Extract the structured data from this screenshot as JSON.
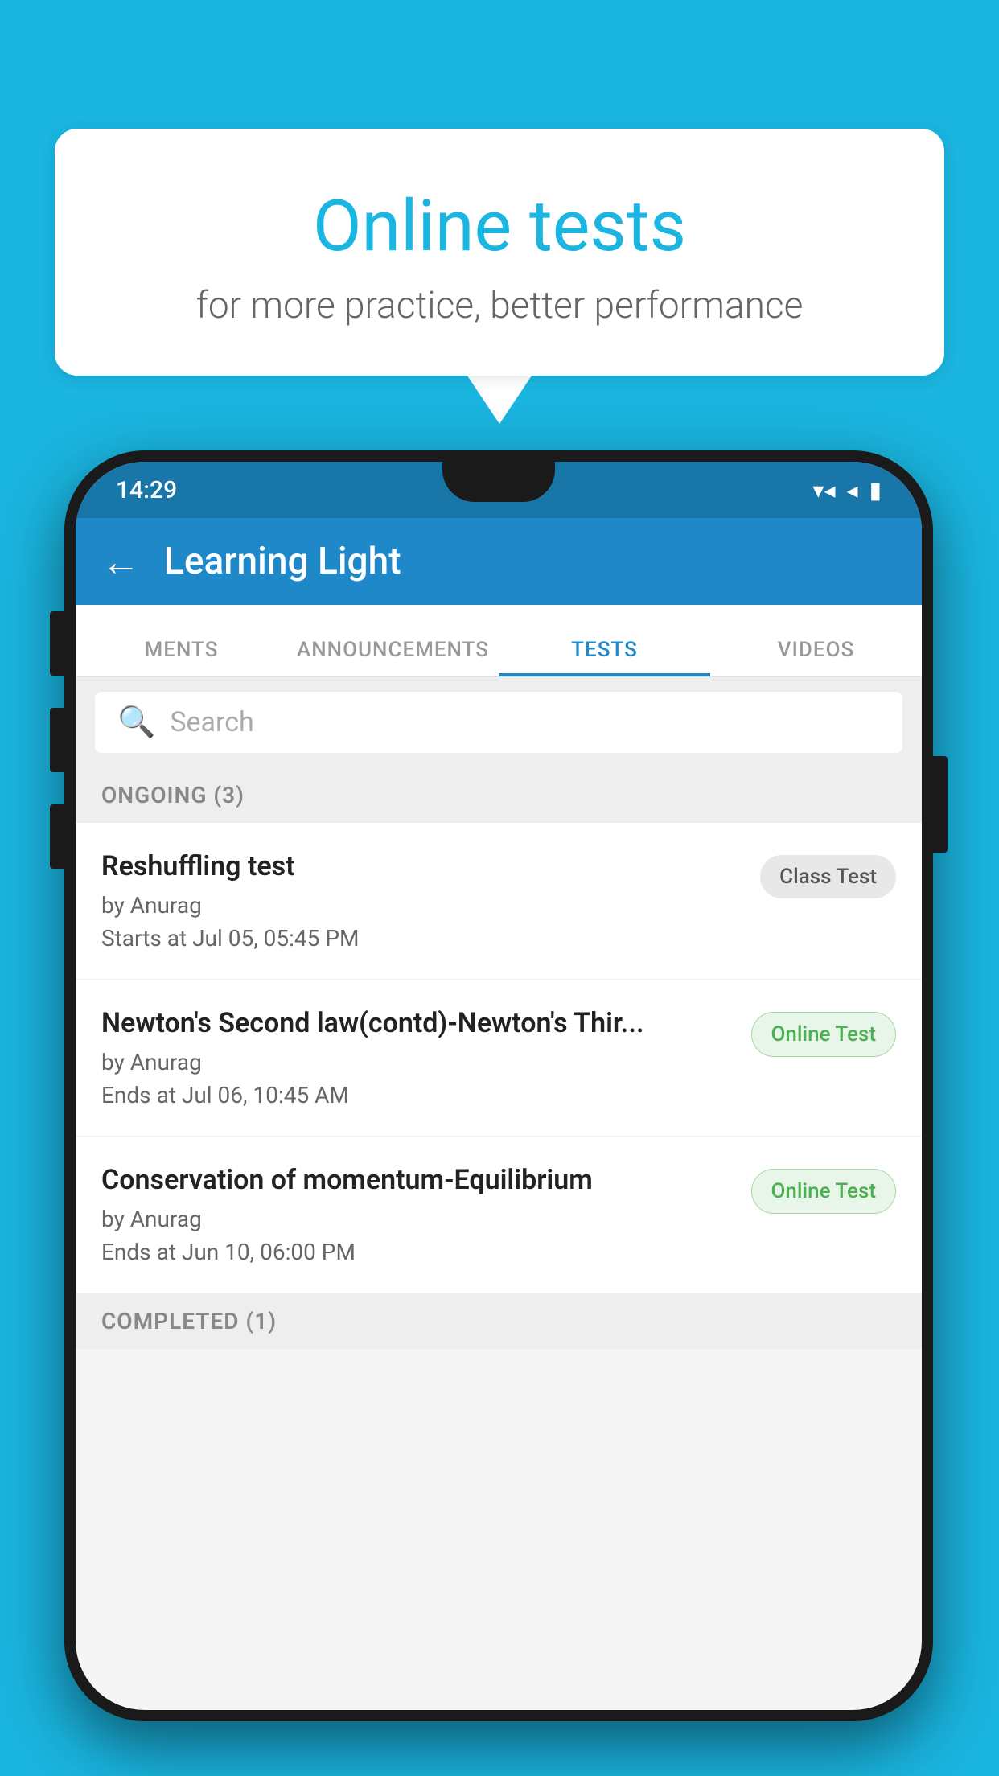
{
  "background_color": "#1ab5e0",
  "speech_bubble": {
    "title": "Online tests",
    "subtitle": "for more practice, better performance"
  },
  "phone": {
    "status_bar": {
      "time": "14:29",
      "wifi_icon": "▼",
      "signal_icon": "◀",
      "battery_icon": "▮"
    },
    "app_bar": {
      "title": "Learning Light",
      "back_label": "←"
    },
    "tabs": [
      {
        "label": "MENTS",
        "active": false
      },
      {
        "label": "ANNOUNCEMENTS",
        "active": false
      },
      {
        "label": "TESTS",
        "active": true
      },
      {
        "label": "VIDEOS",
        "active": false
      }
    ],
    "search": {
      "placeholder": "Search"
    },
    "ongoing_section": {
      "header": "ONGOING (3)",
      "items": [
        {
          "title": "Reshuffling test",
          "author": "by Anurag",
          "date": "Starts at  Jul 05, 05:45 PM",
          "badge": "Class Test",
          "badge_type": "class"
        },
        {
          "title": "Newton's Second law(contd)-Newton's Thir...",
          "author": "by Anurag",
          "date": "Ends at  Jul 06, 10:45 AM",
          "badge": "Online Test",
          "badge_type": "online"
        },
        {
          "title": "Conservation of momentum-Equilibrium",
          "author": "by Anurag",
          "date": "Ends at  Jun 10, 06:00 PM",
          "badge": "Online Test",
          "badge_type": "online"
        }
      ]
    },
    "completed_section": {
      "header": "COMPLETED (1)"
    }
  }
}
